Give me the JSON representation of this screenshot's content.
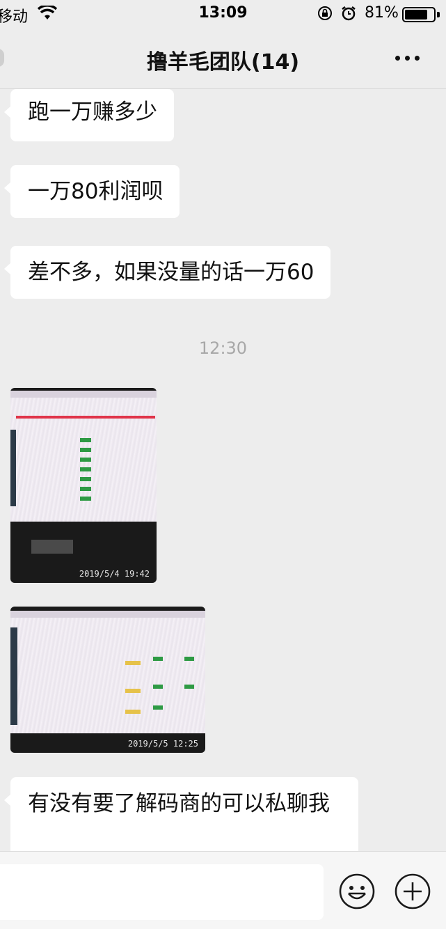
{
  "status_bar": {
    "carrier": "移动",
    "time": "13:09",
    "battery_text": "81%",
    "battery_level": 0.81,
    "icons": [
      "wifi-icon",
      "orientation-lock-icon",
      "alarm-icon",
      "battery-icon"
    ]
  },
  "header": {
    "title": "撸羊毛团队(14)",
    "icons": [
      "back-icon",
      "more-icon"
    ]
  },
  "messages": [
    {
      "type": "text",
      "text": "跑一万赚多少"
    },
    {
      "type": "text",
      "text": "一万80利润呗"
    },
    {
      "type": "text",
      "text": "差不多，如果没量的话一万60"
    },
    {
      "type": "time",
      "text": "12:30"
    },
    {
      "type": "image",
      "stamp": "2019/5/4  19:42"
    },
    {
      "type": "image",
      "stamp": "2019/5/5  12:25"
    },
    {
      "type": "text",
      "text": "有没有要了解码商的可以私聊我"
    }
  ],
  "input_bar": {
    "placeholder": "",
    "icons": [
      "emoji-icon",
      "plus-icon"
    ]
  },
  "colors": {
    "background": "#ededed",
    "bubble": "#ffffff",
    "time_text": "#a8a8a8"
  }
}
